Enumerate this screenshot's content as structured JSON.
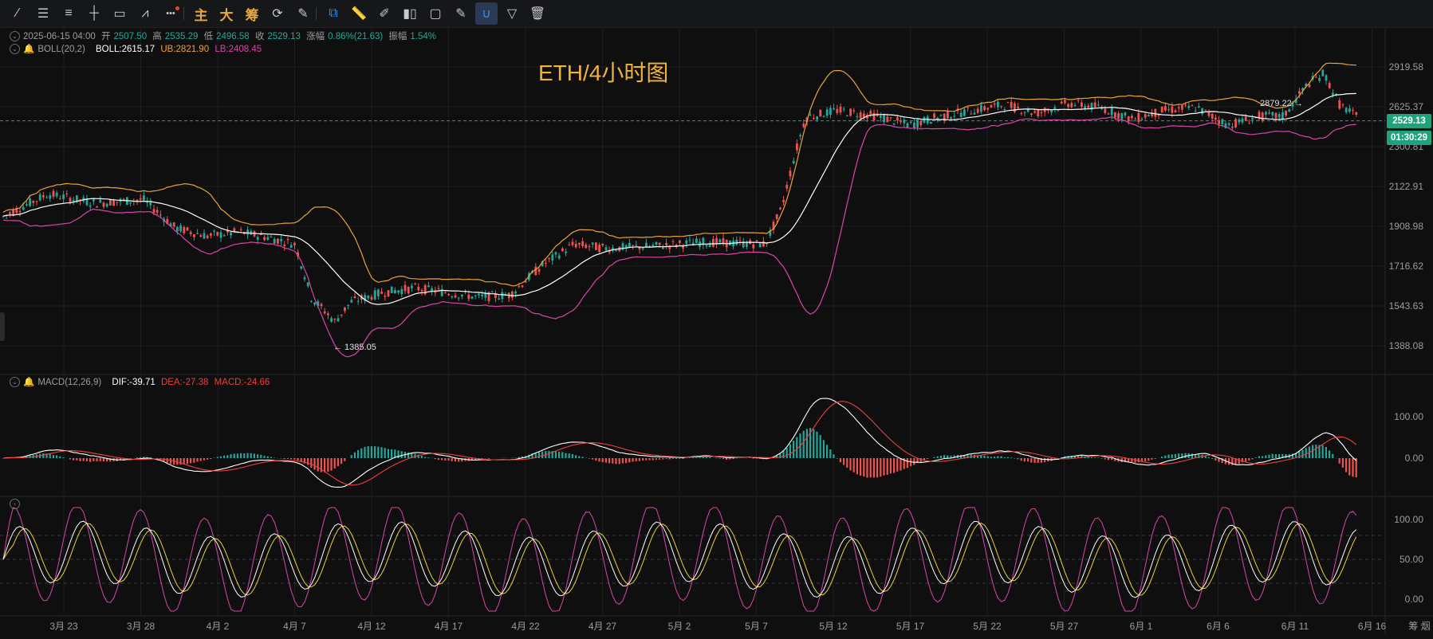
{
  "toolbar": {
    "tools": [
      {
        "name": "trend-line-icon",
        "glyph": "⁄"
      },
      {
        "name": "parallel-lines-icon",
        "glyph": "☰"
      },
      {
        "name": "horizontal-lines-icon",
        "glyph": "≡"
      },
      {
        "name": "cross-line-icon",
        "glyph": "┼"
      },
      {
        "name": "rectangle-icon",
        "glyph": "▭"
      },
      {
        "name": "pattern-icon",
        "glyph": "⩘"
      },
      {
        "name": "more-icon",
        "glyph": "•••"
      }
    ],
    "mode_buttons": [
      "主",
      "大",
      "筹"
    ],
    "tools2": [
      {
        "name": "cycle-icon",
        "glyph": "⟳"
      },
      {
        "name": "pen-icon",
        "glyph": "✎"
      }
    ],
    "tools3": [
      {
        "name": "copy-icon",
        "glyph": "⧉"
      },
      {
        "name": "ruler-icon",
        "glyph": "📏"
      },
      {
        "name": "brush-icon",
        "glyph": "✐"
      },
      {
        "name": "candle-icon",
        "glyph": "▮▯"
      },
      {
        "name": "clipboard-icon",
        "glyph": "▢"
      },
      {
        "name": "edit-icon",
        "glyph": "✎"
      },
      {
        "name": "magnet-icon",
        "glyph": "∪"
      },
      {
        "name": "filter-icon",
        "glyph": "▽"
      },
      {
        "name": "trash-icon",
        "glyph": "🗑"
      }
    ]
  },
  "ohlc": {
    "date": "2025-06-15 04:00",
    "open_label": "开",
    "open": "2507.50",
    "high_label": "高",
    "high": "2535.29",
    "low_label": "低",
    "low": "2496.58",
    "close_label": "收",
    "close": "2529.13",
    "change_label": "涨幅",
    "change": "0.86%(21.63)",
    "amp_label": "振幅",
    "amp": "1.54%"
  },
  "boll": {
    "name": "BOLL(20,2)",
    "mid": "BOLL:2615.17",
    "ub": "UB:2821.90",
    "lb": "LB:2408.45"
  },
  "macd": {
    "name": "MACD(12,26,9)",
    "dif": "DIF:-39.71",
    "dea": "DEA:-27.38",
    "macd": "MACD:-24.66"
  },
  "title": "ETH/4小时图",
  "current_price": "2529.13",
  "countdown": "01:30:29",
  "price_axis": [
    "2919.58",
    "2625.37",
    "2300.81",
    "2122.91",
    "1908.98",
    "1716.62",
    "1543.63",
    "1388.08"
  ],
  "macd_axis": [
    "100.00",
    "0.00"
  ],
  "kdj_axis": [
    "100.00",
    "50.00",
    "0.00"
  ],
  "high_marker": "2879.22",
  "low_marker": "1385.05",
  "x_axis": [
    "3月 23",
    "3月 28",
    "4月 2",
    "4月 7",
    "4月 12",
    "4月 17",
    "4月 22",
    "4月 27",
    "5月 2",
    "5月 7",
    "5月 12",
    "5月 17",
    "5月 22",
    "5月 27",
    "6月 1",
    "6月 6",
    "6月 11",
    "6月 16"
  ],
  "corner_label": "筹 烟",
  "colors": {
    "up": "#26a69a",
    "down": "#ef5350",
    "ub": "#e8a33a",
    "lb": "#d946a8",
    "mid": "#ffffff",
    "macd_dif": "#ffffff",
    "macd_dea": "#ef3e3e",
    "kdj_k": "#ffffff",
    "kdj_d": "#e8d23a",
    "kdj_j": "#d946a8",
    "accent": "#1fa37c"
  }
}
